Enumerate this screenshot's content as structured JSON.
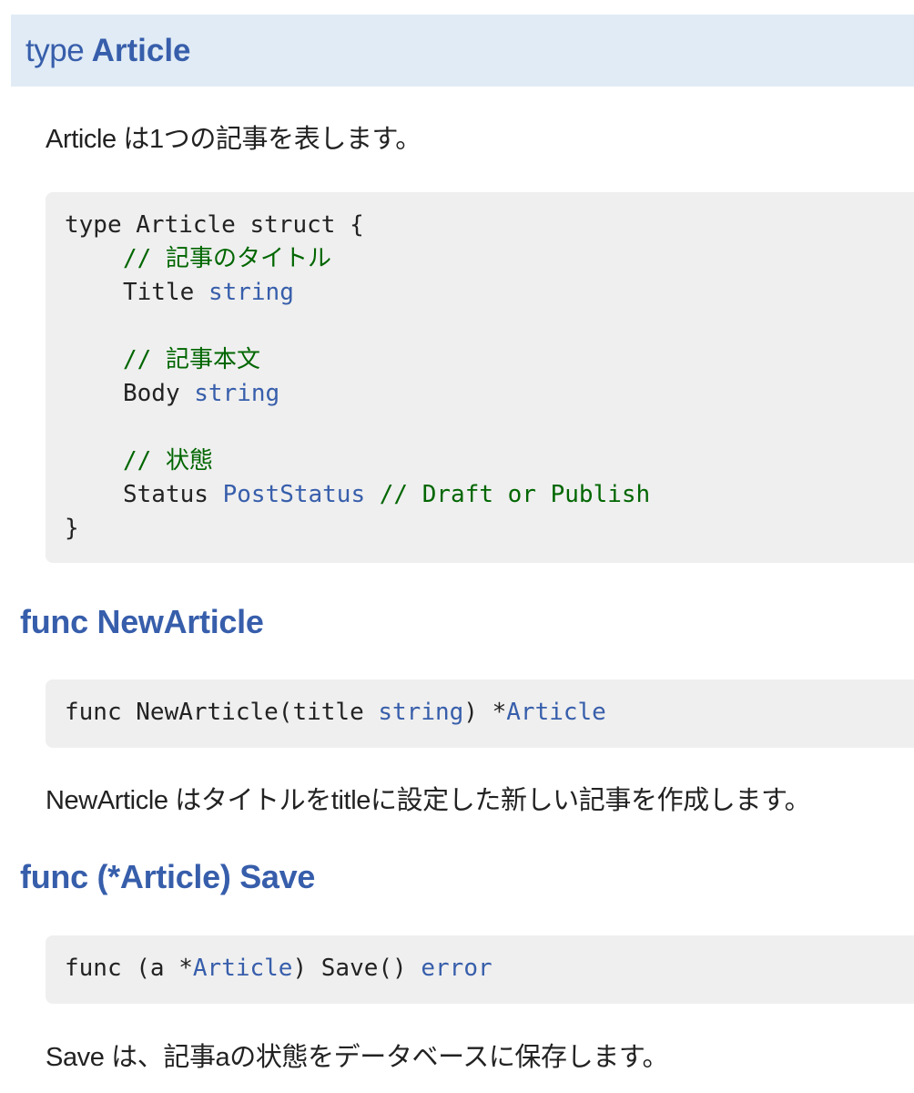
{
  "type_section": {
    "keyword": "type",
    "name": "Article",
    "description": "Article は1つの記事を表します。",
    "code": {
      "decl": "type Article struct {",
      "fields": [
        {
          "comment": "// 記事のタイトル",
          "name": "Title",
          "type": "string",
          "trailing_comment": ""
        },
        {
          "comment": "// 記事本文",
          "name": "Body",
          "type": "string",
          "trailing_comment": ""
        },
        {
          "comment": "// 状態",
          "name": "Status",
          "type": "PostStatus",
          "trailing_comment": "// Draft or Publish"
        }
      ],
      "closing": "}"
    }
  },
  "func_new_article": {
    "heading": "func NewArticle",
    "signature": {
      "prefix": "func NewArticle(title ",
      "param_type": "string",
      "mid": ") *",
      "return_type": "Article"
    },
    "description": "NewArticle はタイトルをtitleに設定した新しい記事を作成します。"
  },
  "func_save": {
    "heading": "func (*Article) Save",
    "signature": {
      "prefix": "func (a *",
      "receiver_type": "Article",
      "mid": ") Save() ",
      "return_type": "error"
    },
    "description": "Save は、記事aの状態をデータベースに保存します。"
  },
  "colors": {
    "link": "#375eab",
    "comment": "#006600",
    "header_bg": "#e0ebf5",
    "code_bg": "#efefef"
  }
}
